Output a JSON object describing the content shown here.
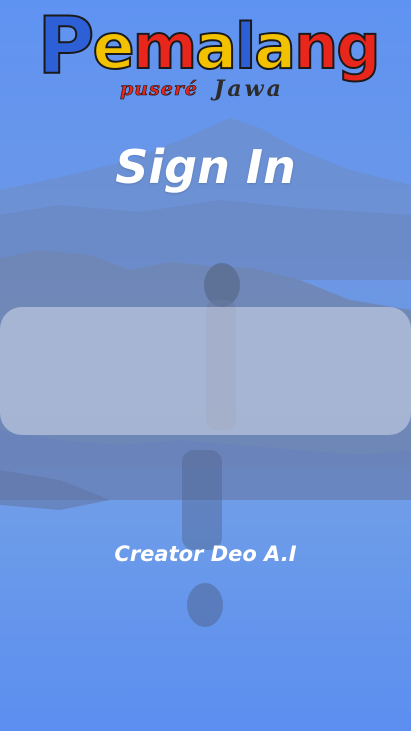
{
  "logo": {
    "wordmark_letters": [
      "P",
      "e",
      "m",
      "a",
      "l",
      "a",
      "n",
      "g"
    ],
    "wordmark_colors": [
      "#2d5fd6",
      "#f2c200",
      "#e8261b",
      "#f2c200",
      "#2d5fd6",
      "#f2c200",
      "#e8261b",
      "#e8261b"
    ],
    "tagline_left": "puseré",
    "tagline_right": "Jawa"
  },
  "screen": {
    "title": "Sign In",
    "creator_credit": "Creator Deo A.I"
  },
  "colors": {
    "overlay": "#5b8ef0",
    "card": "rgba(255,255,255,0.38)"
  }
}
